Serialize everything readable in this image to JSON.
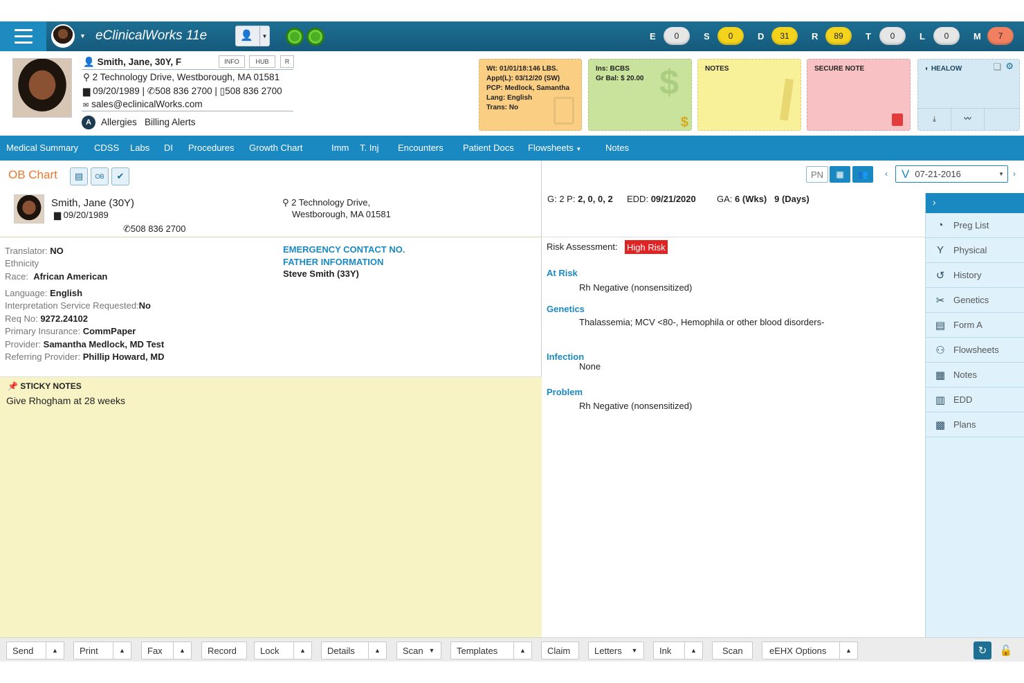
{
  "app": {
    "title": "eClinicalWorks 11e"
  },
  "counters": [
    {
      "label": "E",
      "value": "0",
      "color": "#e6e6e6"
    },
    {
      "label": "S",
      "value": "0",
      "color": "#f4d31c"
    },
    {
      "label": "D",
      "value": "31",
      "color": "#f4d31c"
    },
    {
      "label": "R",
      "value": "89",
      "color": "#f4d31c"
    },
    {
      "label": "T",
      "value": "0",
      "color": "#e6e6e6"
    },
    {
      "label": "L",
      "value": "0",
      "color": "#e6e6e6"
    },
    {
      "label": "M",
      "value": "7",
      "color": "#f08060"
    }
  ],
  "patient": {
    "name_line": "Smith, Jane, 30Y, F",
    "tags": [
      "INFO",
      "HUB",
      "R"
    ],
    "address": "2 Technology Drive, Westborough, MA 01581",
    "dob": "09/20/1989",
    "phone1": "508 836 2700",
    "phone2": "508 836 2700",
    "email": "sales@eclinicalWorks.com",
    "alerts": [
      "Allergies",
      "Billing Alerts"
    ]
  },
  "cards": {
    "orange": [
      "Wt: 01/01/18:146 LBS.",
      "Appt(L): 03/12/20 (SW)",
      "PCP: Medlock, Samantha",
      "Lang: English",
      "Trans: No"
    ],
    "green": [
      "Ins: BCBS",
      "Gr Bal: $ 20.00"
    ],
    "notes": "NOTES",
    "secure": "SECURE NOTE",
    "healow": "HEALOW"
  },
  "nav": [
    "Medical Summary",
    "CDSS",
    "Labs",
    "DI",
    "Procedures",
    "Growth Chart",
    "Imm",
    "T. Inj",
    "Encounters",
    "Patient Docs",
    "Flowsheets",
    "Notes"
  ],
  "ob": {
    "title": "OB Chart",
    "name": "Smith, Jane (30Y)",
    "dob": "09/20/1989",
    "phone": "508 836 2700",
    "addr1": "2 Technology Drive,",
    "addr2": "Westborough, MA 01581",
    "details": [
      {
        "label": "Translator:",
        "value": "NO"
      },
      {
        "label": "Ethnicity",
        "value": ""
      },
      {
        "label": "Race:",
        "value": "African American"
      },
      {
        "label": "Language:",
        "value": "English"
      },
      {
        "label": "Interpretation Service Requested:",
        "value": "No"
      },
      {
        "label": "Req No:",
        "value": "9272.24102"
      },
      {
        "label": "Primary Insurance:",
        "value": "CommPaper"
      },
      {
        "label": "Provider:",
        "value": "Samantha Medlock, MD Test"
      },
      {
        "label": "Referring Provider:",
        "value": "Phillip Howard, MD"
      }
    ],
    "emergency": "EMERGENCY CONTACT NO.",
    "father_hdr": "FATHER INFORMATION",
    "father": "Steve Smith (33Y)",
    "sticky_title": "STICKY NOTES",
    "sticky_text": "Give Rhogham at 28 weeks"
  },
  "right": {
    "pn": "PN",
    "date": "07-21-2016",
    "summary": {
      "gp_label": "G: 2 P:",
      "gp": "2, 0, 0, 2",
      "edd_label": "EDD:",
      "edd": "09/21/2020",
      "ga_label": "GA:",
      "ga_wks": "6 (Wks)",
      "ga_days": "9 (Days)"
    },
    "risk_label": "Risk Assessment:",
    "risk": "High Risk",
    "sections": [
      {
        "title": "At Risk",
        "text": "Rh Negative (nonsensitized)"
      },
      {
        "title": "Genetics",
        "text": "Thalassemia; MCV <80-, Hemophila or other blood disorders-"
      },
      {
        "title": "Infection",
        "text": "None"
      },
      {
        "title": "Problem",
        "text": "Rh Negative (nonsensitized)"
      }
    ],
    "sidebar": [
      "Preg List",
      "Physical",
      "History",
      "Genetics",
      "Form A",
      "Flowsheets",
      "Notes",
      "EDD",
      "Plans"
    ]
  },
  "bottom": [
    "Send",
    "Print",
    "Fax",
    "Record",
    "Lock",
    "Details",
    "Scan",
    "Templates",
    "Claim",
    "Letters",
    "Ink",
    "Scan",
    "eEHX Options"
  ]
}
